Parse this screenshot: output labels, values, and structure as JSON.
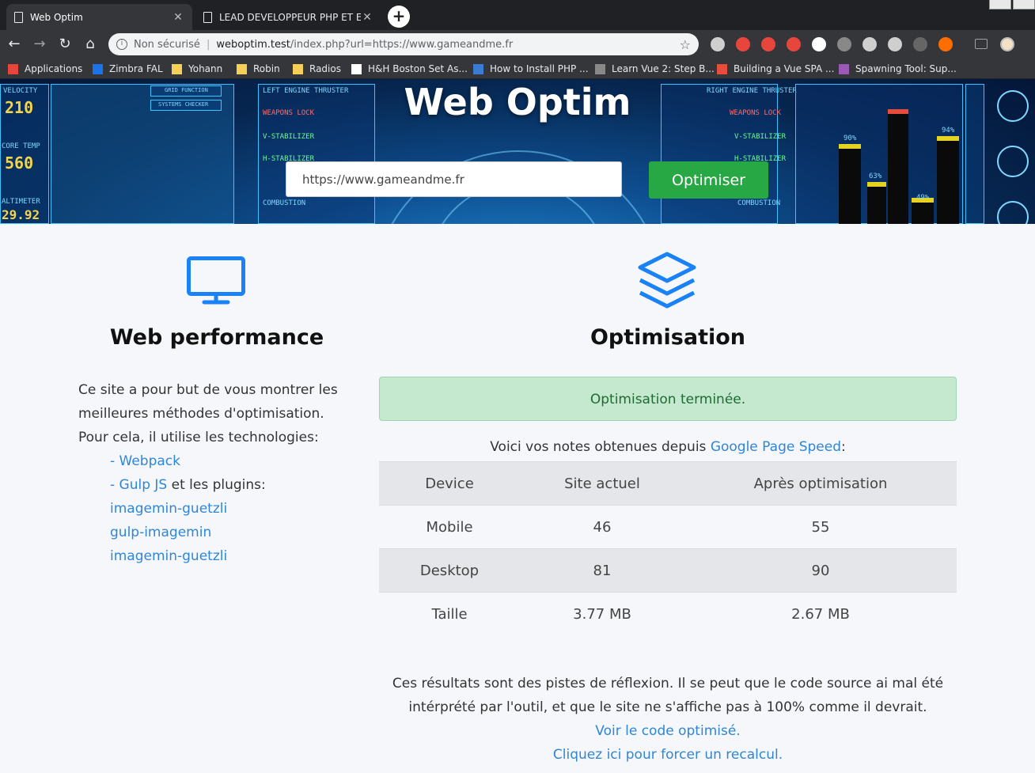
{
  "browser": {
    "tabs": [
      {
        "title": "Web Optim",
        "active": true
      },
      {
        "title": "LEAD DEVELOPPEUR PHP ET EXP",
        "active": false
      }
    ],
    "new_tab_glyph": "+",
    "address": {
      "security_label": "Non sécurisé",
      "host": "weboptim.test",
      "path": "/index.php?url=https://www.gameandme.fr"
    },
    "bookmarks": [
      {
        "label": "Applications",
        "icon": "apps-grid-icon",
        "color": "#e8453c"
      },
      {
        "label": "Zimbra FAL",
        "icon": "zimbra-icon",
        "color": "#1a73e8"
      },
      {
        "label": "Yohann",
        "icon": "folder-icon",
        "color": "#f6cf57"
      },
      {
        "label": "Robin",
        "icon": "folder-icon",
        "color": "#f6cf57"
      },
      {
        "label": "Radios",
        "icon": "folder-icon",
        "color": "#f6cf57"
      },
      {
        "label": "H&H Boston Set As...",
        "icon": "amazon-icon",
        "color": "#ffffff"
      },
      {
        "label": "How to Install PHP ...",
        "icon": "page-icon",
        "color": "#3a7bd5"
      },
      {
        "label": "Learn Vue 2: Step B...",
        "icon": "arrow-icon",
        "color": "#888888"
      },
      {
        "label": "Building a Vue SPA ...",
        "icon": "ln-icon",
        "color": "#e84c3d"
      },
      {
        "label": "Spawning Tool: Sup...",
        "icon": "st-icon",
        "color": "#9b59b6"
      }
    ],
    "extensions_colors": [
      "#cfcfcf",
      "#e8453c",
      "#e8453c",
      "#e8453c",
      "#ffffff",
      "#888888",
      "#cfcfcf",
      "#cfcfcf",
      "#666666",
      "#ff6d00"
    ]
  },
  "hero": {
    "title": "Web Optim",
    "url_value": "https://www.gameandme.fr",
    "button_label": "Optimiser",
    "hud": {
      "velocity_label": "VELOCITY",
      "velocity_value": "210",
      "core_temp_label": "CORE TEMP",
      "core_temp_value": "560",
      "altimeter_label": "ALTIMETER",
      "altimeter_value": "29.92",
      "grid_function": "GRID FUNCTION",
      "systems_checker": "SYSTEMS CHECKER",
      "left_thruster": "LEFT ENGINE THRUSTER",
      "right_thruster": "RIGHT ENGINE THRUSTER",
      "weapons_lock": "WEAPONS LOCK",
      "v_stabilizer": "V-STABILIZER",
      "h_stabilizer": "H-STABILIZER",
      "combustion": "COMBUSTION",
      "pct_90": "90%",
      "pct_94": "94%",
      "pct_63": "63%",
      "pct_49": "49%"
    }
  },
  "performance": {
    "title": "Web performance",
    "lines": [
      "Ce site a pour but de vous montrer les",
      "meilleures méthodes d'optimisation.",
      "Pour cela, il utilise les technologies:"
    ],
    "webpack_link": "- Webpack",
    "gulp_link": "- Gulp JS",
    "gulp_suffix": " et les plugins:",
    "plugins": [
      "imagemin-guetzli",
      "gulp-imagemin",
      "imagemin-guetzli"
    ]
  },
  "optimisation": {
    "title": "Optimisation",
    "alert": "Optimisation terminée.",
    "intro_text": "Voici vos notes obtenues depuis ",
    "intro_link": "Google Page Speed",
    "intro_suffix": ":",
    "table": {
      "headers": [
        "Device",
        "Site actuel",
        "Après optimisation"
      ],
      "rows": [
        [
          "Mobile",
          "46",
          "55"
        ],
        [
          "Desktop",
          "81",
          "90"
        ],
        [
          "Taille",
          "3.77 MB",
          "2.67 MB"
        ]
      ]
    },
    "note_line1": "Ces résultats sont des pistes de réflexion. Il se peut que le code source ai mal été",
    "note_line2": "intérprété par l'outil, et que le site ne s'affiche pas à 100% comme il devrait.",
    "see_code_link": "Voir le code optimisé.",
    "recalc_link": "Cliquez ici pour forcer un recalcul."
  },
  "colors": {
    "accent": "#2f86d8",
    "success_btn": "#28a745",
    "alert_bg": "#c5e9cf",
    "icon_blue": "#1a82f7"
  }
}
